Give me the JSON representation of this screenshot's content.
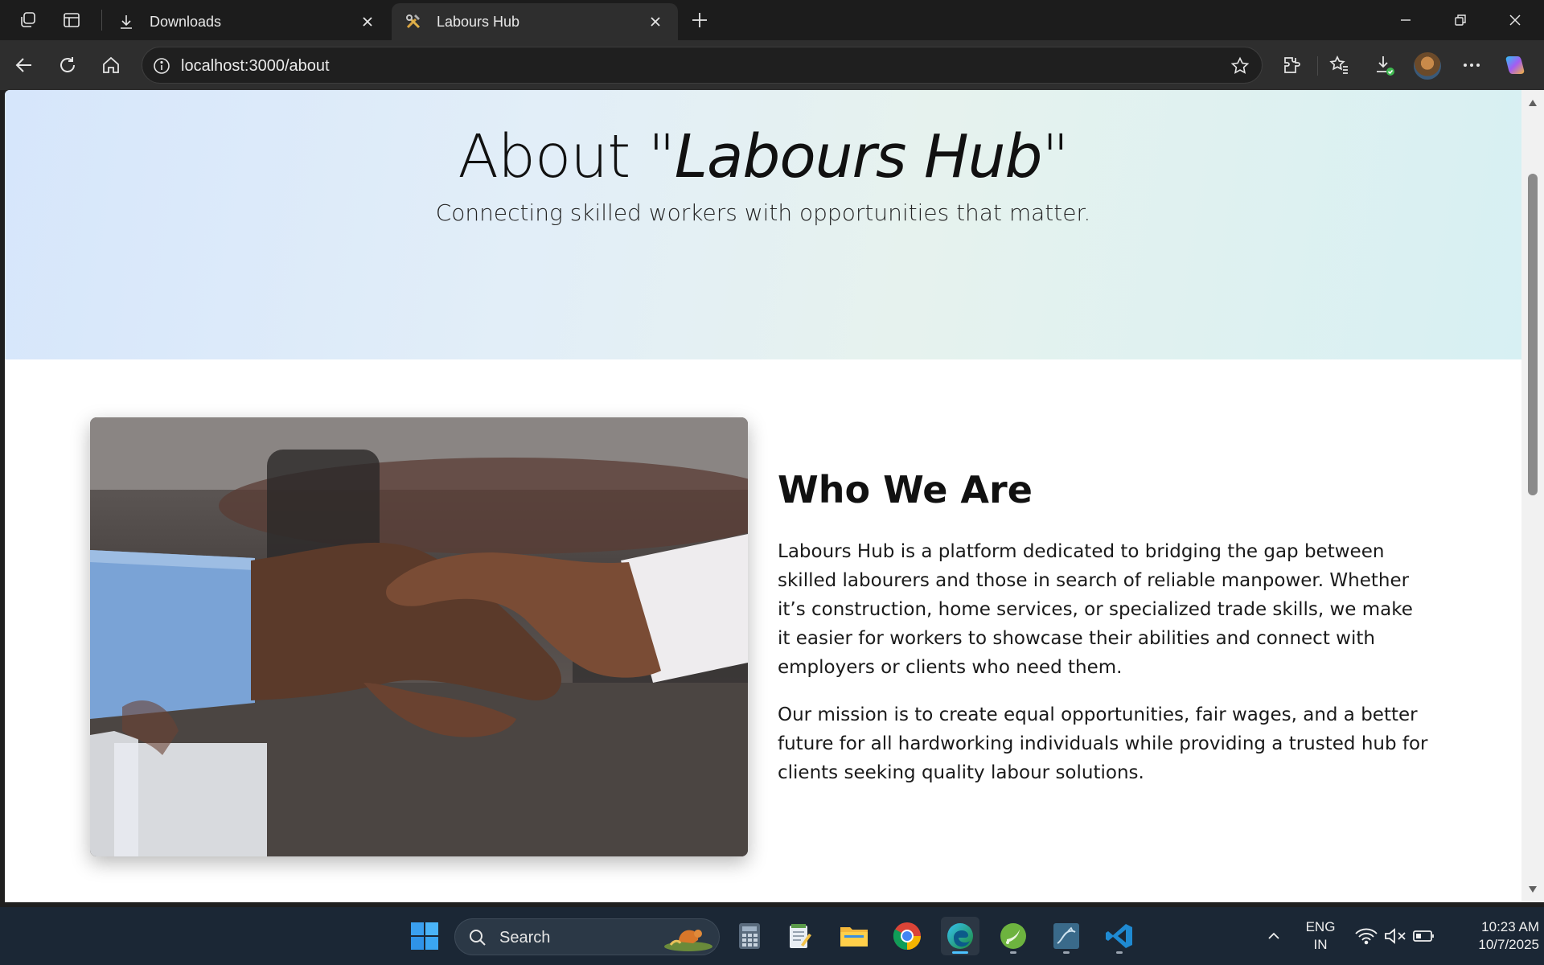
{
  "browser": {
    "tabs": [
      {
        "title": "Downloads",
        "icon": "download-icon",
        "active": false
      },
      {
        "title": "Labours Hub",
        "icon": "hammer-wrench-icon",
        "active": true
      }
    ],
    "address": "localhost:3000/about"
  },
  "hero": {
    "title_prefix": "About \"",
    "title_brand": "Labours Hub",
    "title_suffix": "\"",
    "subtitle": "Connecting skilled workers with opportunities that matter."
  },
  "about": {
    "image_label": "handshake-photo",
    "heading": "Who We Are",
    "paragraph1": "Labours Hub is a platform dedicated to bridging the gap between skilled labourers and those in search of reliable manpower. Whether it’s construction, home services, or specialized trade skills, we make it easier for workers to showcase their abilities and connect with employers or clients who need them.",
    "paragraph2": "Our mission is to create equal opportunities, fair wages, and a better future for all hardworking individuals while providing a trusted hub for clients seeking quality labour solutions."
  },
  "taskbar": {
    "search_placeholder": "Search",
    "language": "ENG",
    "region": "IN",
    "time": "10:23 AM",
    "date": "10/7/2025",
    "apps": [
      "start-icon",
      "calculator-icon",
      "notepad-icon",
      "file-explorer-icon",
      "chrome-icon",
      "edge-icon",
      "spring-icon",
      "mysql-icon",
      "vscode-icon"
    ]
  },
  "colors": {
    "accent": "#4cc2ff",
    "hero_gradient_start": "#d6e6fb",
    "hero_gradient_end": "#d7f0f3",
    "taskbar": "#1b2735"
  }
}
